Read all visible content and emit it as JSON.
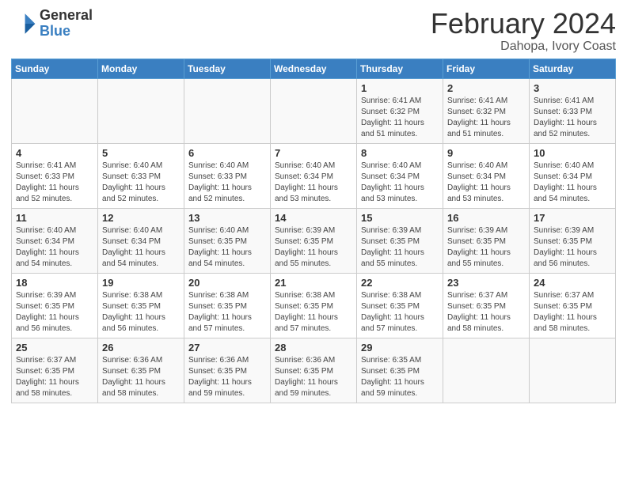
{
  "logo": {
    "general": "General",
    "blue": "Blue"
  },
  "calendar": {
    "title": "February 2024",
    "subtitle": "Dahopa, Ivory Coast"
  },
  "weekdays": [
    "Sunday",
    "Monday",
    "Tuesday",
    "Wednesday",
    "Thursday",
    "Friday",
    "Saturday"
  ],
  "weeks": [
    [
      {
        "day": "",
        "info": ""
      },
      {
        "day": "",
        "info": ""
      },
      {
        "day": "",
        "info": ""
      },
      {
        "day": "",
        "info": ""
      },
      {
        "day": "1",
        "info": "Sunrise: 6:41 AM\nSunset: 6:32 PM\nDaylight: 11 hours and 51 minutes."
      },
      {
        "day": "2",
        "info": "Sunrise: 6:41 AM\nSunset: 6:32 PM\nDaylight: 11 hours and 51 minutes."
      },
      {
        "day": "3",
        "info": "Sunrise: 6:41 AM\nSunset: 6:33 PM\nDaylight: 11 hours and 52 minutes."
      }
    ],
    [
      {
        "day": "4",
        "info": "Sunrise: 6:41 AM\nSunset: 6:33 PM\nDaylight: 11 hours and 52 minutes."
      },
      {
        "day": "5",
        "info": "Sunrise: 6:40 AM\nSunset: 6:33 PM\nDaylight: 11 hours and 52 minutes."
      },
      {
        "day": "6",
        "info": "Sunrise: 6:40 AM\nSunset: 6:33 PM\nDaylight: 11 hours and 52 minutes."
      },
      {
        "day": "7",
        "info": "Sunrise: 6:40 AM\nSunset: 6:34 PM\nDaylight: 11 hours and 53 minutes."
      },
      {
        "day": "8",
        "info": "Sunrise: 6:40 AM\nSunset: 6:34 PM\nDaylight: 11 hours and 53 minutes."
      },
      {
        "day": "9",
        "info": "Sunrise: 6:40 AM\nSunset: 6:34 PM\nDaylight: 11 hours and 53 minutes."
      },
      {
        "day": "10",
        "info": "Sunrise: 6:40 AM\nSunset: 6:34 PM\nDaylight: 11 hours and 54 minutes."
      }
    ],
    [
      {
        "day": "11",
        "info": "Sunrise: 6:40 AM\nSunset: 6:34 PM\nDaylight: 11 hours and 54 minutes."
      },
      {
        "day": "12",
        "info": "Sunrise: 6:40 AM\nSunset: 6:34 PM\nDaylight: 11 hours and 54 minutes."
      },
      {
        "day": "13",
        "info": "Sunrise: 6:40 AM\nSunset: 6:35 PM\nDaylight: 11 hours and 54 minutes."
      },
      {
        "day": "14",
        "info": "Sunrise: 6:39 AM\nSunset: 6:35 PM\nDaylight: 11 hours and 55 minutes."
      },
      {
        "day": "15",
        "info": "Sunrise: 6:39 AM\nSunset: 6:35 PM\nDaylight: 11 hours and 55 minutes."
      },
      {
        "day": "16",
        "info": "Sunrise: 6:39 AM\nSunset: 6:35 PM\nDaylight: 11 hours and 55 minutes."
      },
      {
        "day": "17",
        "info": "Sunrise: 6:39 AM\nSunset: 6:35 PM\nDaylight: 11 hours and 56 minutes."
      }
    ],
    [
      {
        "day": "18",
        "info": "Sunrise: 6:39 AM\nSunset: 6:35 PM\nDaylight: 11 hours and 56 minutes."
      },
      {
        "day": "19",
        "info": "Sunrise: 6:38 AM\nSunset: 6:35 PM\nDaylight: 11 hours and 56 minutes."
      },
      {
        "day": "20",
        "info": "Sunrise: 6:38 AM\nSunset: 6:35 PM\nDaylight: 11 hours and 57 minutes."
      },
      {
        "day": "21",
        "info": "Sunrise: 6:38 AM\nSunset: 6:35 PM\nDaylight: 11 hours and 57 minutes."
      },
      {
        "day": "22",
        "info": "Sunrise: 6:38 AM\nSunset: 6:35 PM\nDaylight: 11 hours and 57 minutes."
      },
      {
        "day": "23",
        "info": "Sunrise: 6:37 AM\nSunset: 6:35 PM\nDaylight: 11 hours and 58 minutes."
      },
      {
        "day": "24",
        "info": "Sunrise: 6:37 AM\nSunset: 6:35 PM\nDaylight: 11 hours and 58 minutes."
      }
    ],
    [
      {
        "day": "25",
        "info": "Sunrise: 6:37 AM\nSunset: 6:35 PM\nDaylight: 11 hours and 58 minutes."
      },
      {
        "day": "26",
        "info": "Sunrise: 6:36 AM\nSunset: 6:35 PM\nDaylight: 11 hours and 58 minutes."
      },
      {
        "day": "27",
        "info": "Sunrise: 6:36 AM\nSunset: 6:35 PM\nDaylight: 11 hours and 59 minutes."
      },
      {
        "day": "28",
        "info": "Sunrise: 6:36 AM\nSunset: 6:35 PM\nDaylight: 11 hours and 59 minutes."
      },
      {
        "day": "29",
        "info": "Sunrise: 6:35 AM\nSunset: 6:35 PM\nDaylight: 11 hours and 59 minutes."
      },
      {
        "day": "",
        "info": ""
      },
      {
        "day": "",
        "info": ""
      }
    ]
  ]
}
